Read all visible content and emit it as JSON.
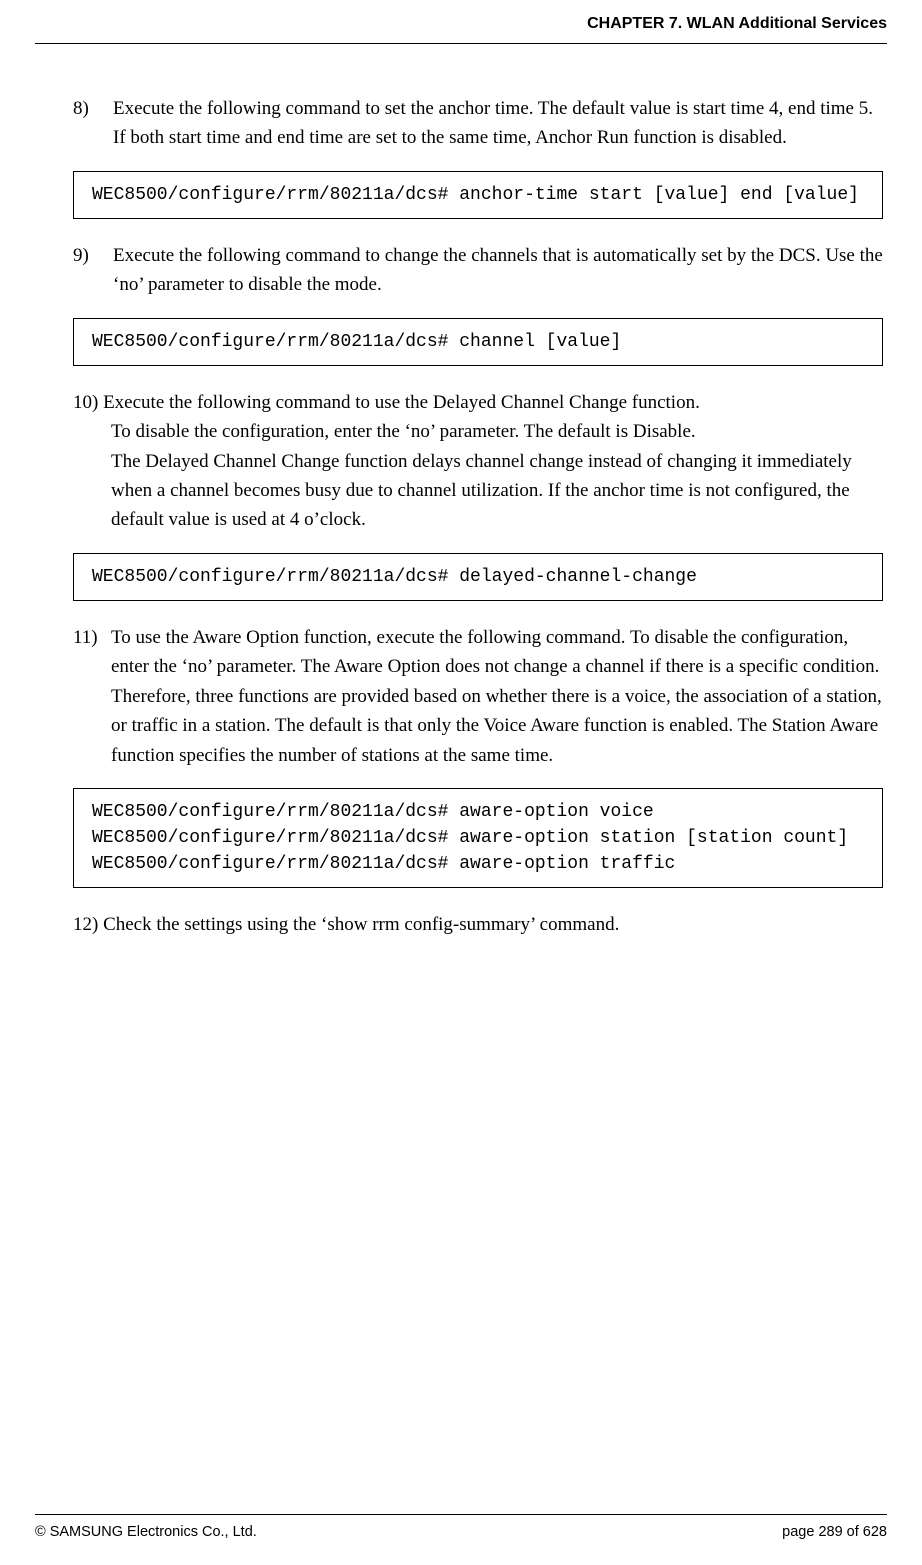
{
  "header": {
    "chapter": "CHAPTER 7. WLAN Additional Services"
  },
  "items": [
    {
      "num": "8)",
      "text": "Execute the following command to set the anchor time. The default value is start time 4, end time 5. If both start time and end time are set to the same time, Anchor Run function is disabled.",
      "code": "WEC8500/configure/rrm/80211a/dcs# anchor-time start [value] end [value]"
    },
    {
      "num": "9)",
      "text": "Execute the following command to change the channels that is automatically set by the DCS. Use the ‘no’ parameter to disable the mode.",
      "code": "WEC8500/configure/rrm/80211a/dcs# channel [value]"
    },
    {
      "num": "10)",
      "text": "Execute the following command to use the Delayed Channel Change function.\nTo disable the configuration, enter the ‘no’ parameter. The default is Disable.\nThe Delayed Channel Change function delays channel change instead of changing it immediately when a channel becomes busy due to channel utilization. If the anchor time is not configured, the default value is used at 4 o’clock.",
      "code": "WEC8500/configure/rrm/80211a/dcs# delayed-channel-change"
    },
    {
      "num": "11)",
      "text": "To use the Aware Option function, execute the following command. To disable the configuration, enter the ‘no’ parameter. The Aware Option does not change a channel if there is a specific condition. Therefore, three functions are provided based on whether there is a voice, the association of a station, or traffic in a station. The default is that only the Voice Aware function is enabled. The Station Aware function specifies the number of stations at the same time.",
      "code": "WEC8500/configure/rrm/80211a/dcs# aware-option voice\nWEC8500/configure/rrm/80211a/dcs# aware-option station [station count]\nWEC8500/configure/rrm/80211a/dcs# aware-option traffic"
    },
    {
      "num": "12)",
      "text": "Check the settings using the ‘show rrm config-summary’ command.",
      "code": null
    }
  ],
  "footer": {
    "copyright": "© SAMSUNG Electronics Co., Ltd.",
    "page": "page 289 of 628"
  }
}
